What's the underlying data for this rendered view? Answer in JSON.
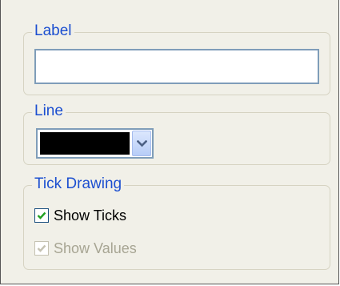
{
  "label_group": {
    "title": "Label",
    "input_value": "",
    "input_placeholder": ""
  },
  "line_group": {
    "title": "Line",
    "selected_color": "#000000"
  },
  "tick_group": {
    "title": "Tick Drawing",
    "show_ticks": {
      "label": "Show Ticks",
      "checked": true,
      "enabled": true
    },
    "show_values": {
      "label": "Show Values",
      "checked": true,
      "enabled": false
    }
  },
  "colors": {
    "group_title": "#1c4fd0",
    "panel_background": "#f1f0e8",
    "check_mark_enabled": "#21a121",
    "check_mark_disabled": "#c5c2b2"
  },
  "icons": {
    "combo_arrow": "chevron-down-icon",
    "checkbox_mark": "checkmark-icon"
  }
}
